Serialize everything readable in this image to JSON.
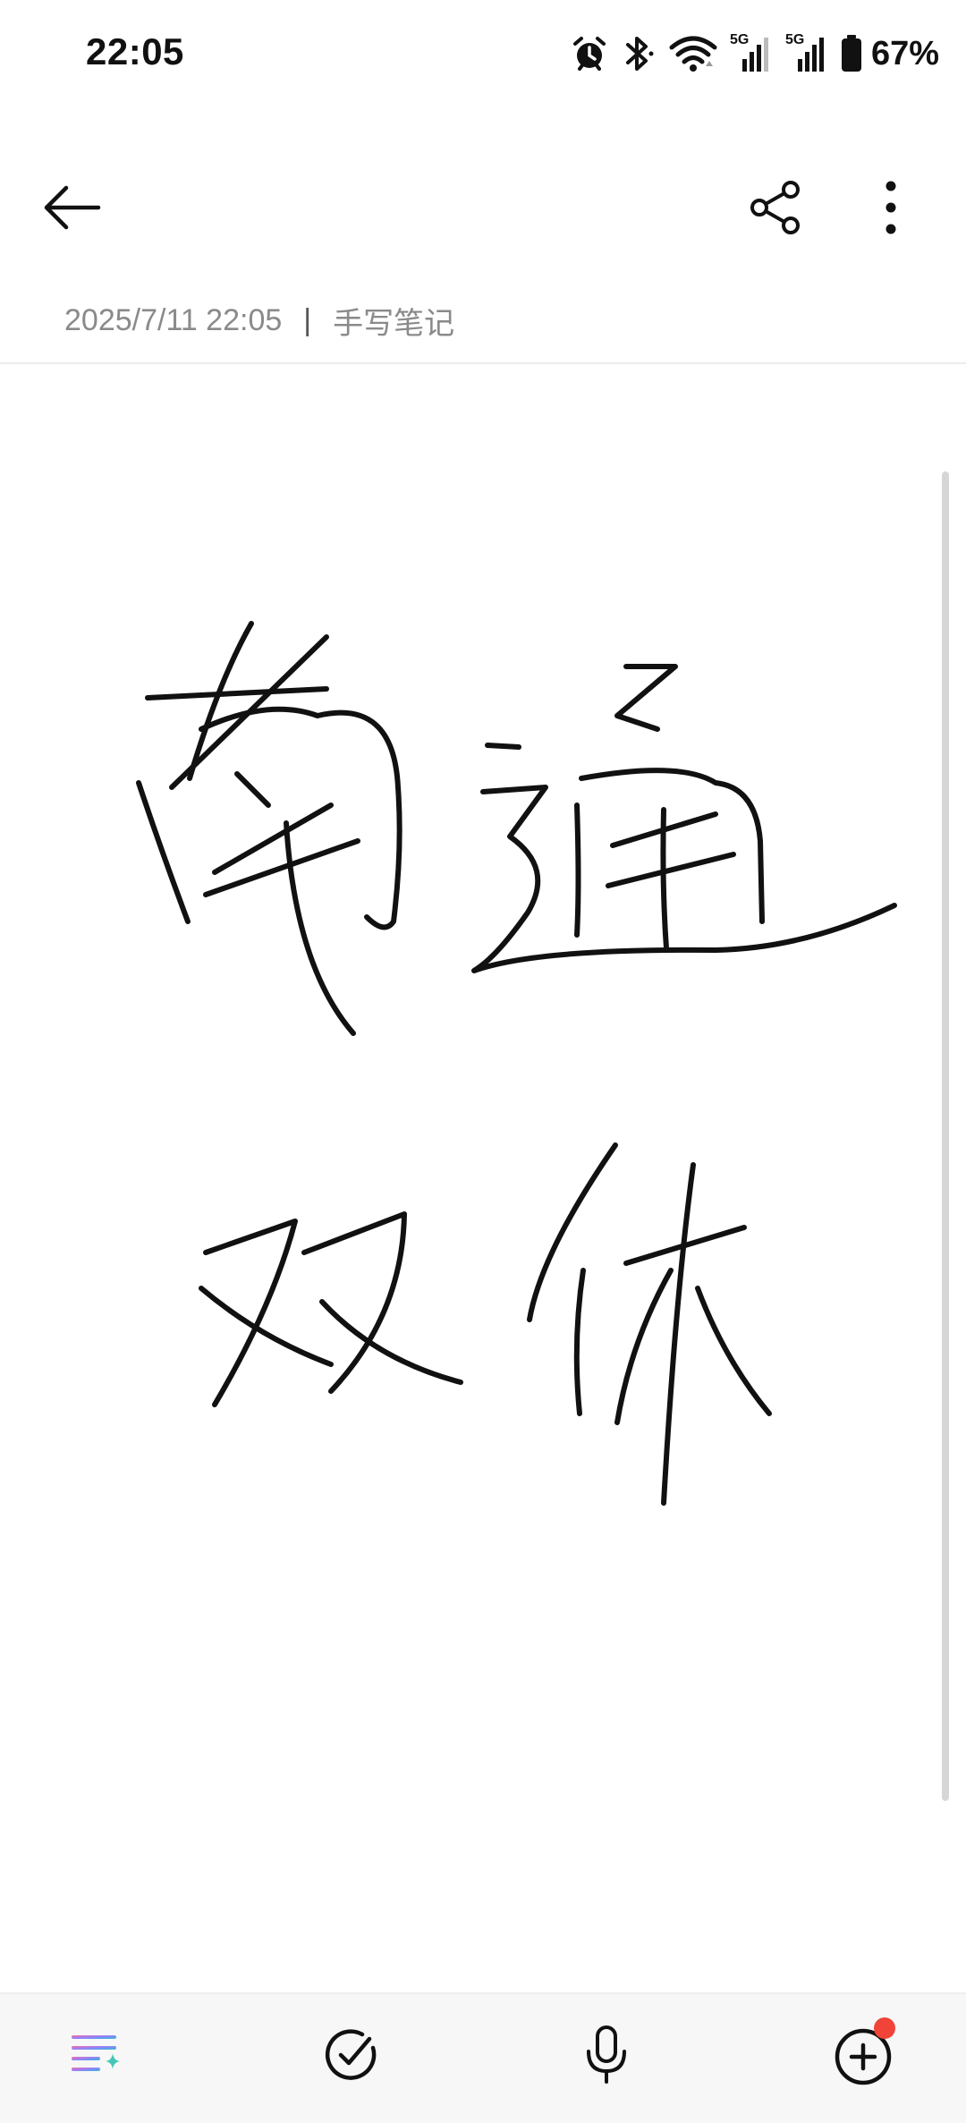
{
  "status_bar": {
    "time": "22:05",
    "battery_percent": "67%",
    "icons": [
      "alarm-icon",
      "bluetooth-icon",
      "wifi-icon",
      "signal-5g-icon",
      "signal-5g-icon",
      "battery-icon"
    ],
    "signal_label_1": "5G",
    "signal_label_2": "5G"
  },
  "toolbar": {
    "back_icon": "arrow-left-icon",
    "share_icon": "share-icon",
    "more_icon": "more-vertical-icon"
  },
  "note": {
    "timestamp": "2025/7/11 22:05",
    "separator": "|",
    "category": "手写笔记"
  },
  "bottom_bar": {
    "items": [
      {
        "name": "ai-format-icon",
        "accent": [
          "#f36ea0",
          "#a67cf4",
          "#5b9cf2",
          "#43c7b6"
        ]
      },
      {
        "name": "checklist-icon"
      },
      {
        "name": "microphone-icon"
      },
      {
        "name": "add-circle-icon",
        "badge_color": "#f04438"
      }
    ]
  },
  "colors": {
    "ink": "#111111",
    "meta_text": "#8a8a8a",
    "notification_dot": "#f04438"
  }
}
